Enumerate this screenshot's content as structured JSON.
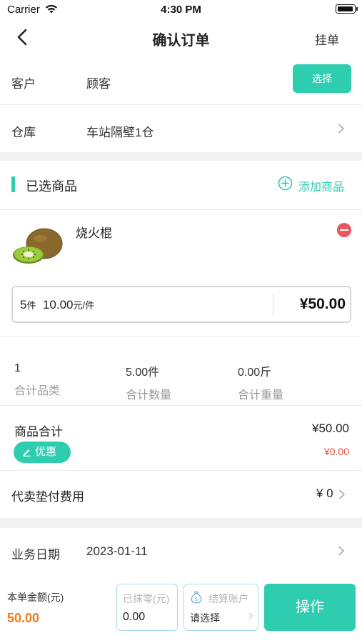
{
  "status_bar": {
    "carrier": "Carrier",
    "time": "4:30 PM"
  },
  "nav": {
    "title": "确认订单",
    "hold_label": "挂单"
  },
  "customer": {
    "label": "客户",
    "value": "顾客",
    "select_label": "选择"
  },
  "warehouse": {
    "label": "仓库",
    "value": "车站隔壁1仓"
  },
  "selected_goods": {
    "title": "已选商品",
    "add_label": "添加商品"
  },
  "product": {
    "name": "烧火棍",
    "quantity": "5",
    "quantity_unit": "件",
    "unit_price": "10.00",
    "unit_price_suffix": "元/件",
    "total": "¥50.00"
  },
  "stats": [
    {
      "value": "1",
      "label": "合计品类"
    },
    {
      "value": "5.00件",
      "label": "合计数量"
    },
    {
      "value": "0.00斤",
      "label": "合计重量"
    }
  ],
  "goods_total": {
    "label": "商品合计",
    "value": "¥50.00",
    "discount_label": "优惠",
    "discount_value": "¥0.00"
  },
  "agent_fee": {
    "label": "代卖垫付费用",
    "value": "¥ 0"
  },
  "business_date": {
    "label": "业务日期",
    "value": "2023-01-11"
  },
  "bottom": {
    "total_label": "本单金额(元)",
    "total_value": "50.00",
    "rounding_label": "已抹零(元)",
    "rounding_value": "0.00",
    "account_label": "结算账户",
    "account_placeholder": "请选择",
    "action_label": "操作"
  },
  "colors": {
    "accent": "#2ecdb0",
    "danger": "#e84c3d",
    "amount": "#f07c15"
  }
}
